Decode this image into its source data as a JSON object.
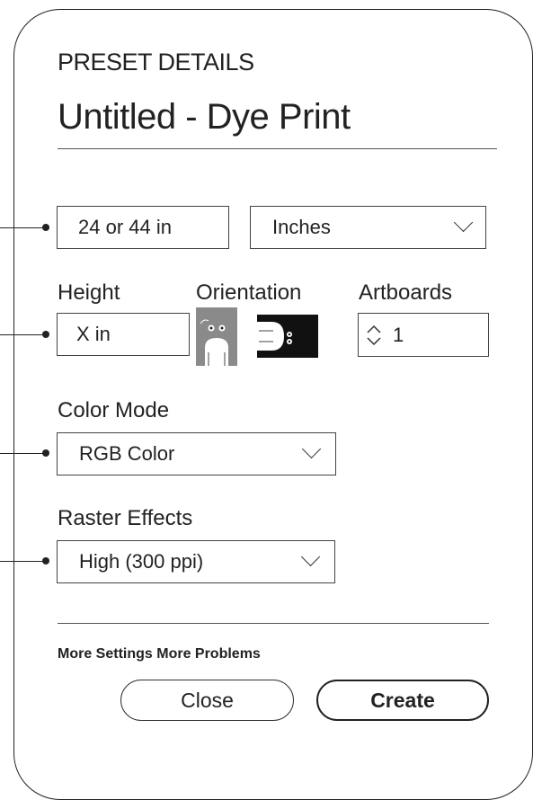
{
  "header": {
    "section_title": "PRESET DETAILS",
    "preset_name": "Untitled - Dye Print"
  },
  "width": {
    "value": "24 or 44 in",
    "units_selected": "Inches"
  },
  "size_labels": {
    "height": "Height",
    "orientation": "Orientation",
    "artboards": "Artboards"
  },
  "height": {
    "value": "X in"
  },
  "orientation": {
    "options": [
      "portrait",
      "landscape"
    ]
  },
  "artboards": {
    "value": "1"
  },
  "color_mode": {
    "label": "Color Mode",
    "selected": "RGB Color"
  },
  "raster_effects": {
    "label": "Raster Effects",
    "selected": "High (300 ppi)"
  },
  "footer": {
    "more_settings": "More Settings More Problems",
    "close_label": "Close",
    "create_label": "Create"
  },
  "icons": [
    "chevron-down-icon",
    "stepper-arrows-icon",
    "portrait-orientation-icon",
    "landscape-orientation-icon"
  ]
}
